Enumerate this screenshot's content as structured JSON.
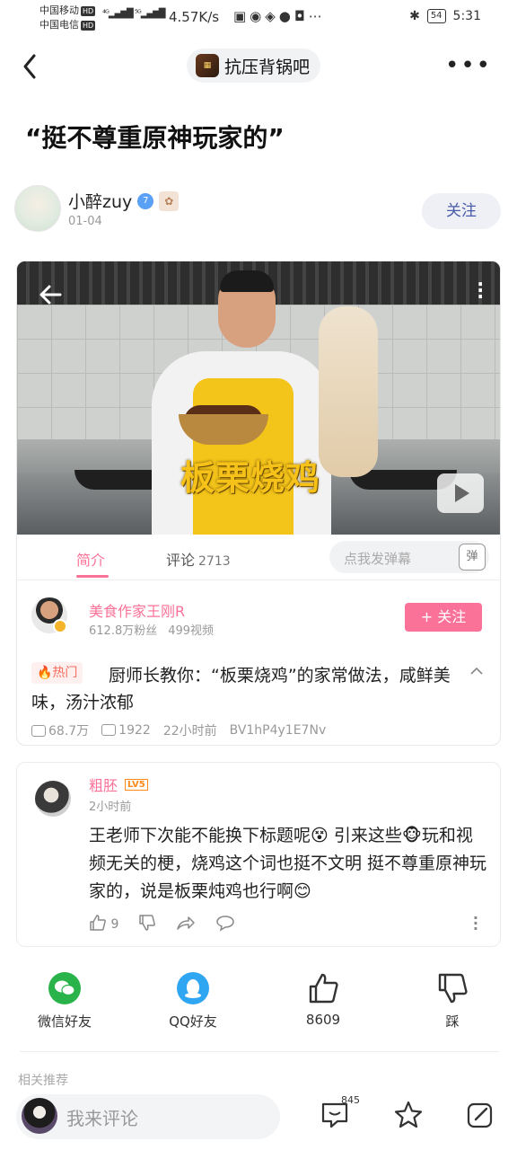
{
  "status_bar": {
    "carrier1": "中国移动",
    "carrier2": "中国电信",
    "hd": "HD",
    "speed": "4.57K/s",
    "battery": "54",
    "time": "5:31"
  },
  "nav": {
    "forum_name": "抗压背锅吧"
  },
  "post": {
    "title": "“挺不尊重原神玩家的”",
    "author": "小醉zuy",
    "author_level": "7",
    "date": "01-04",
    "follow_label": "关注"
  },
  "video": {
    "caption": "板栗烧鸡",
    "tabs": {
      "intro": "简介",
      "comments": "评论",
      "comment_count": "2713"
    },
    "danmaku_placeholder": "点我发弹幕",
    "danmaku_icon": "弹",
    "uploader": {
      "name": "美食作家王刚R",
      "fans": "612.8万粉丝",
      "videos": "499视频",
      "follow_label": "+ 关注"
    },
    "hot_tag": "🔥热门",
    "description": "厨师长教你：“板栗烧鸡”的家常做法，咸鲜美味，汤汁浓郁",
    "views": "68.7万",
    "danmaku_count": "1922",
    "time_ago": "22小时前",
    "bvid": "BV1hP4y1E7Nv"
  },
  "comment": {
    "user": "粗胚",
    "level": "LV5",
    "time": "2小时前",
    "text": "王老师下次能不能换下标题呢😵 引来这些🐵玩和视频无关的梗，烧鸡这个词也挺不文明 挺不尊重原神玩家的，说是板栗炖鸡也行啊😊",
    "likes": "9"
  },
  "share": {
    "wechat": "微信好友",
    "qq": "QQ好友",
    "like_count": "8609",
    "dislike": "踩"
  },
  "related_label": "相关推荐",
  "bottom": {
    "placeholder": "我来评论",
    "comment_count": "845"
  },
  "colors": {
    "accent_pink": "#fb7299",
    "wechat_green": "#2bb34b",
    "qq_blue": "#2fa6f2"
  }
}
